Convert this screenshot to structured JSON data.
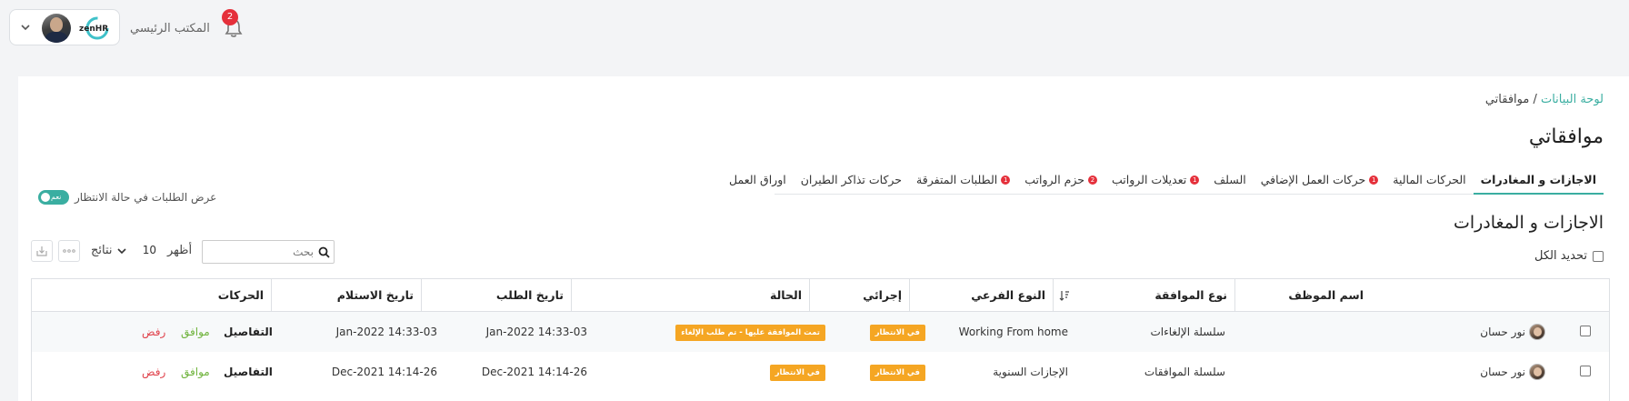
{
  "header": {
    "office_label": "المكتب الرئيسي",
    "notification_count": "2",
    "logo_text": "zenHR"
  },
  "breadcrumb": {
    "root": "لوحة البيانات",
    "separator": " / ",
    "current": "موافقاتي"
  },
  "page_title": "موافقاتي",
  "tabs": [
    {
      "label": "الاجازات و المغادرات",
      "active": true,
      "count": ""
    },
    {
      "label": "الحركات المالية",
      "active": false,
      "count": ""
    },
    {
      "label": "حركات العمل الإضافي",
      "active": false,
      "count": "1"
    },
    {
      "label": "السلف",
      "active": false,
      "count": ""
    },
    {
      "label": "تعديلات الرواتب",
      "active": false,
      "count": "1"
    },
    {
      "label": "حزم الرواتب",
      "active": false,
      "count": "2"
    },
    {
      "label": "الطلبات المتفرقة",
      "active": false,
      "count": "1"
    },
    {
      "label": "حركات تذاكر الطيران",
      "active": false,
      "count": ""
    },
    {
      "label": "اوراق العمل",
      "active": false,
      "count": ""
    }
  ],
  "section_title": "الاجازات و المغادرات",
  "pending_toggle": {
    "label": "عرض الطلبات في حالة الانتظار",
    "state": "نعم"
  },
  "select_all_label": "تحديد الكل",
  "toolbar": {
    "show_label": "أظهر",
    "page_size": "10",
    "results_label": "نتائج",
    "search_placeholder": "بحث"
  },
  "table": {
    "headers": {
      "employee": "اسم الموظف",
      "approval_type": "نوع الموافقة",
      "subtype": "النوع الفرعي",
      "my_action": "إجرائي",
      "status": "الحالة",
      "request_date": "تاريخ الطلب",
      "received_date": "تاريخ الاستلام",
      "actions": "الحركات"
    },
    "rows": [
      {
        "employee": "نور حسان",
        "approval_type": "سلسلة الإلغاءات",
        "subtype": "Working From home",
        "my_action": "في الانتظار",
        "status": "تمت الموافقة عليها - تم طلب الإلغاء",
        "request_date": "03-Jan-2022 14:33",
        "received_date": "03-Jan-2022 14:33",
        "details": "التفاصيل",
        "approve": "موافق",
        "reject": "رفض"
      },
      {
        "employee": "نور حسان",
        "approval_type": "سلسلة الموافقات",
        "subtype": "الإجازات السنوية",
        "my_action": "في الانتظار",
        "status": "في الانتظار",
        "request_date": "26-Dec-2021 14:14",
        "received_date": "26-Dec-2021 14:14",
        "details": "التفاصيل",
        "approve": "موافق",
        "reject": "رفض"
      }
    ]
  },
  "colors": {
    "accent": "#3aaea1",
    "badge": "#f5a623",
    "approve": "#6fb33c",
    "reject": "#e0444d",
    "alert": "#e5303b"
  },
  "icons": [
    "chevron-down-icon",
    "bell-icon",
    "search-icon",
    "more-icon",
    "download-icon",
    "sort-icon"
  ]
}
